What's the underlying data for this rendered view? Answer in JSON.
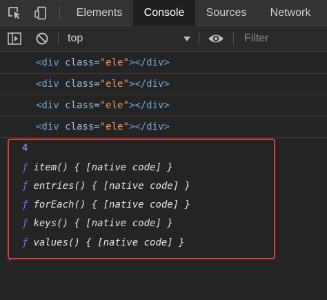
{
  "tabs": [
    {
      "label": "Elements",
      "active": false
    },
    {
      "label": "Console",
      "active": true
    },
    {
      "label": "Sources",
      "active": false
    },
    {
      "label": "Network",
      "active": false
    }
  ],
  "toolbar": {
    "context": "top",
    "filter_placeholder": "Filter"
  },
  "console": {
    "html_lines": [
      {
        "tag_open": "<div",
        "attr": " class=",
        "value": "\"ele\"",
        "tag_close": "></div>"
      },
      {
        "tag_open": "<div",
        "attr": " class=",
        "value": "\"ele\"",
        "tag_close": "></div>"
      },
      {
        "tag_open": "<div",
        "attr": " class=",
        "value": "\"ele\"",
        "tag_close": "></div>"
      },
      {
        "tag_open": "<div",
        "attr": " class=",
        "value": "\"ele\"",
        "tag_close": "></div>"
      }
    ],
    "number": "4",
    "fn_prefix": "ƒ",
    "functions": [
      "item() { [native code] }",
      "entries() { [native code] }",
      "forEach() { [native code] }",
      "keys() { [native code] }",
      "values() { [native code] }"
    ],
    "prompt": "›"
  },
  "colors": {
    "highlight_border": "#e53935",
    "tag": "#6fa8dc",
    "string": "#f29766",
    "number": "#a395ff",
    "function_marker": "#5d7ce8"
  }
}
